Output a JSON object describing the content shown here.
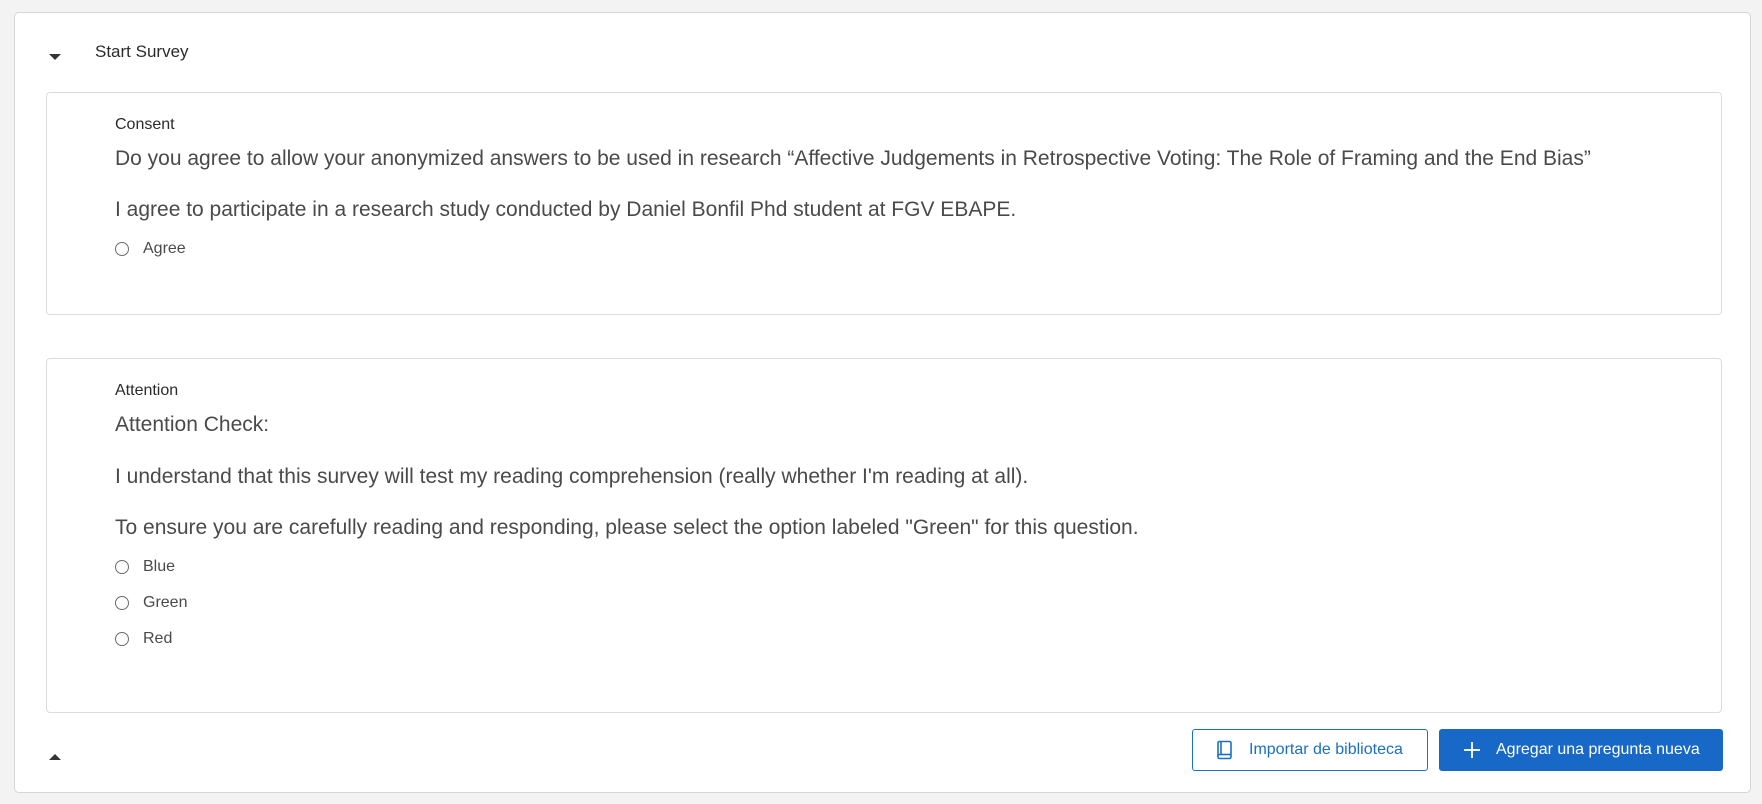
{
  "block": {
    "title": "Start Survey",
    "collapse_icon": "chevron-down-icon",
    "footer_collapse_icon": "chevron-up-icon"
  },
  "questions": [
    {
      "label": "Consent",
      "text_lines": [
        "Do you agree to allow your anonymized answers to be used in research “Affective Judgements in Retrospective Voting: The Role of Framing and the End Bias”",
        "I agree to participate in a research study conducted by Daniel Bonfil Phd student at FGV EBAPE."
      ],
      "choices": [
        "Agree"
      ]
    },
    {
      "label": "Attention",
      "text_lines": [
        "Attention Check:",
        "I understand that this survey will test my reading comprehension (really whether I'm reading at all).",
        "To ensure you are carefully reading and responding, please select the option labeled \"Green\" for this question."
      ],
      "choices": [
        "Blue",
        "Green",
        "Red"
      ]
    }
  ],
  "actions": {
    "import_label": "Importar de biblioteca",
    "import_icon": "book-icon",
    "add_label": "Agregar una pregunta nueva",
    "add_icon": "plus-icon"
  },
  "colors": {
    "primary": "#1868c8",
    "secondary_text": "#1a6fc4",
    "background": "#f3f3f3"
  }
}
